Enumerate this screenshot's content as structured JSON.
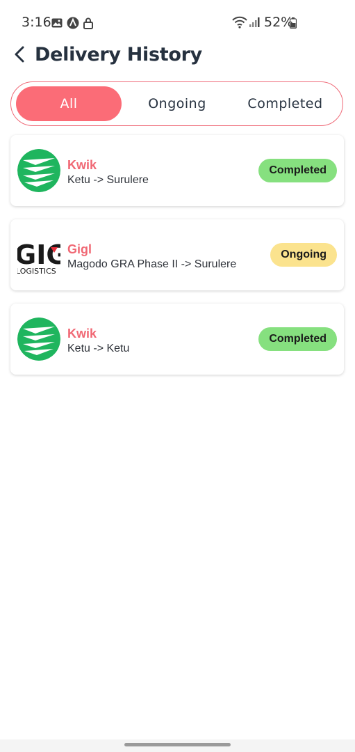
{
  "status_bar": {
    "time": "3:16",
    "battery": "52%",
    "icons_left": [
      "image-icon",
      "a-circle-icon",
      "lock-icon"
    ],
    "icons_right": [
      "wifi-icon",
      "signal-icon",
      "battery-icon"
    ]
  },
  "header": {
    "title": "Delivery History"
  },
  "tabs": [
    {
      "label": "All",
      "active": true
    },
    {
      "label": "Ongoing",
      "active": false
    },
    {
      "label": "Completed",
      "active": false
    }
  ],
  "deliveries": [
    {
      "company": "Kwik",
      "route": "Ketu -> Surulere",
      "status": "Completed",
      "logo": "kwik-logo"
    },
    {
      "company": "Gigl",
      "route": "Magodo GRA Phase II -> Surulere",
      "status": "Ongoing",
      "logo": "gig-logistics-logo",
      "logo_text": {
        "big": "GIG",
        "small": "LOGISTICS"
      }
    },
    {
      "company": "Kwik",
      "route": "Ketu -> Ketu",
      "status": "Completed",
      "logo": "kwik-logo"
    }
  ],
  "colors": {
    "accent": "#fb6c77",
    "title": "#26313f",
    "completed_badge": "#86e07f",
    "ongoing_badge": "#fbe38e",
    "kwik_green": "#1fb55e"
  }
}
